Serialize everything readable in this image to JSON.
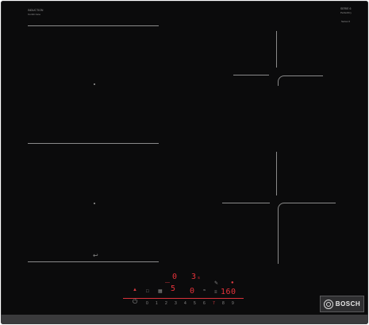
{
  "hob": {
    "brand": "BOSCH",
    "top_left_label": "INDUCTION",
    "top_left_sublabel": "Combi zone",
    "top_right_label": "SERIE 6",
    "top_right_sublabel": "PerfectFry",
    "top_right_tiny": "Series 6"
  },
  "display": {
    "timer_top_left": "0",
    "timer_top_right": "3",
    "timer_top_right_suffix": "s",
    "mid_left": "5",
    "mid_right": "0",
    "power_right": "160",
    "slider_numbers": [
      "0",
      "1",
      "2",
      "3",
      "4",
      "5",
      "6",
      "7",
      "8",
      "9"
    ]
  },
  "icons": [
    "lock-icon",
    "power-icon",
    "combi-zone-icon",
    "flex-zone-icon",
    "timer-icon",
    "perfectfry-icon",
    "menu-icon",
    "wifi-icon",
    "stopwatch-icon"
  ],
  "colors": {
    "glass": "#0b0b0c",
    "display_red": "#e5323a",
    "marking_grey": "#8a8a8a",
    "frame": "#3a3a3c"
  }
}
